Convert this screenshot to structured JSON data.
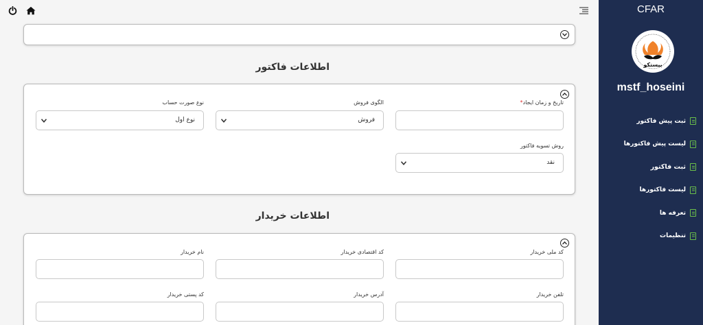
{
  "app": {
    "title": "CFAR",
    "username": "mstf_hoseini",
    "logo_text": "بیستکو"
  },
  "topbar": {
    "power_icon": "power-icon",
    "home_icon": "home-icon",
    "menu_icon": "menu-toggle-icon"
  },
  "sidebar": {
    "items": [
      {
        "label": "ثبت پیش فاکتور"
      },
      {
        "label": "لیست پیش فاکتورها"
      },
      {
        "label": "ثبت فاکتور"
      },
      {
        "label": "لیست فاکتورها"
      },
      {
        "label": "تعرفه ها"
      },
      {
        "label": "تنظیمات"
      }
    ]
  },
  "invoice": {
    "title": "اطلاعات فاکتور",
    "created_label": "تاریخ و زمان ایجاد",
    "required_mark": "*",
    "created_value": "",
    "sales_pattern_label": "الگوی فروش",
    "sales_pattern_value": "فروش",
    "invoice_type_label": "نوع صورت حساب",
    "invoice_type_value": "نوع اول",
    "settlement_label": "روش تسویه فاکتور",
    "settlement_value": "نقد"
  },
  "buyer": {
    "title": "اطلاعات خریدار",
    "national_id_label": "کد ملی خریدار",
    "economic_code_label": "کد اقتصادی خریدار",
    "name_label": "نام خریدار",
    "phone_label": "تلفن خریدار",
    "address_label": "آدرس خریدار",
    "postal_code_label": "کد پستی خریدار"
  },
  "colors": {
    "sidebar_bg": "#1e2d50",
    "menu_icon_color": "#6cc24a",
    "required": "#dd3333"
  }
}
